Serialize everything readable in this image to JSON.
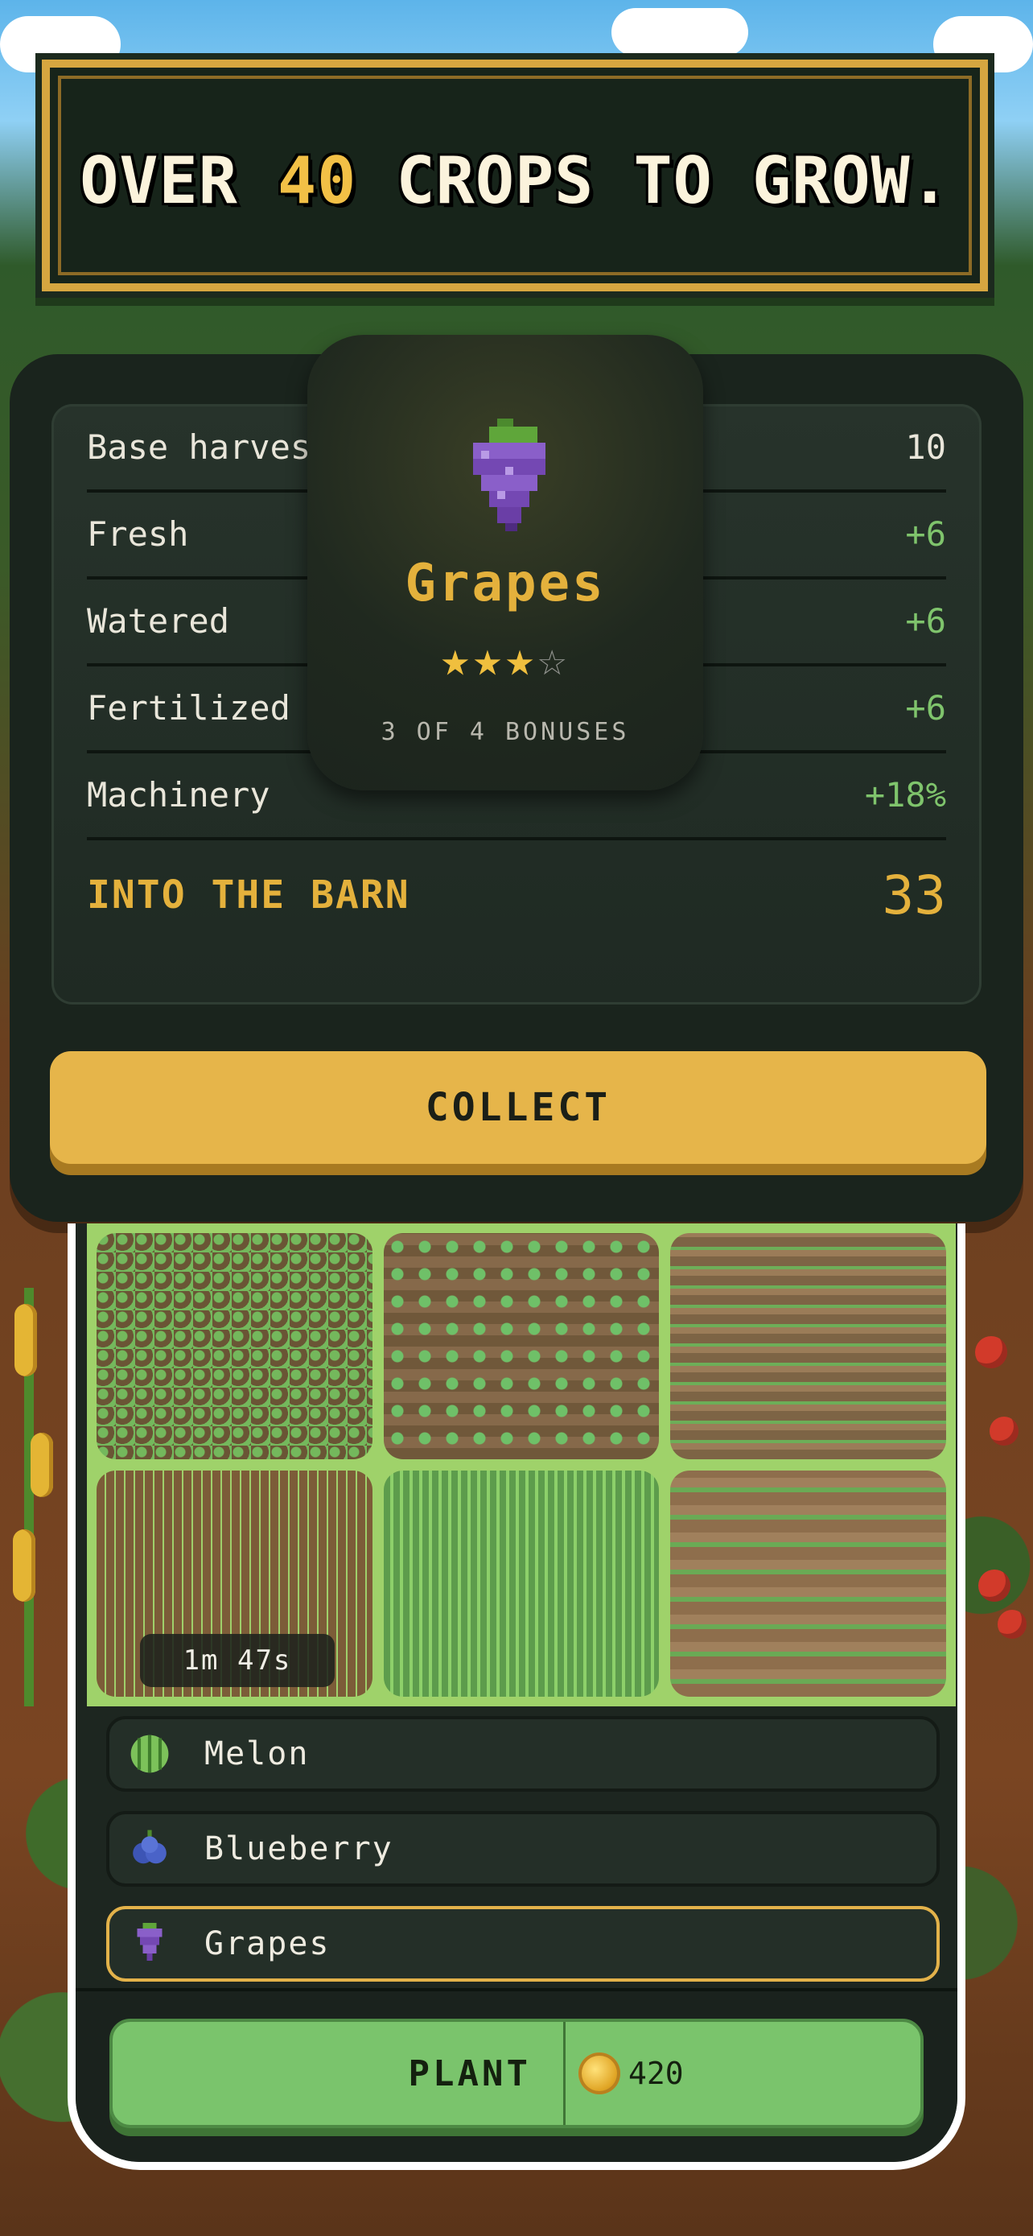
{
  "banner": {
    "prefix": "OVER",
    "highlight": "40",
    "suffix": "CROPS TO GROW."
  },
  "harvest": {
    "rows": [
      {
        "label": "Base harvest",
        "value": "10",
        "bonus": false
      },
      {
        "label": "Fresh",
        "value": "+6",
        "bonus": true
      },
      {
        "label": "Watered",
        "value": "+6",
        "bonus": true
      },
      {
        "label": "Fertilized",
        "value": "+6",
        "bonus": true
      },
      {
        "label": "Machinery",
        "value": "+18%",
        "bonus": true
      }
    ],
    "total_label": "INTO THE BARN",
    "total_value": "33"
  },
  "crop_card": {
    "name": "Grapes",
    "stars_filled": 3,
    "stars_total": 4,
    "bonuses_text": "3 OF 4 BONUSES",
    "icon": "grapes-icon"
  },
  "collect_label": "COLLECT",
  "plots": {
    "timer": "1m 47s"
  },
  "crop_list": [
    {
      "label": "Melon",
      "icon": "melon-icon",
      "selected": false
    },
    {
      "label": "Blueberry",
      "icon": "blueberry-icon",
      "selected": false
    },
    {
      "label": "Grapes",
      "icon": "grapes-icon",
      "selected": true
    }
  ],
  "plant": {
    "label": "PLANT",
    "cost": "420",
    "currency_icon": "coin-icon"
  },
  "colors": {
    "accent_gold": "#e4b13c",
    "bonus_green": "#7fc46c",
    "plant_green": "#7ac46c",
    "panel_dark": "#1a241d"
  }
}
